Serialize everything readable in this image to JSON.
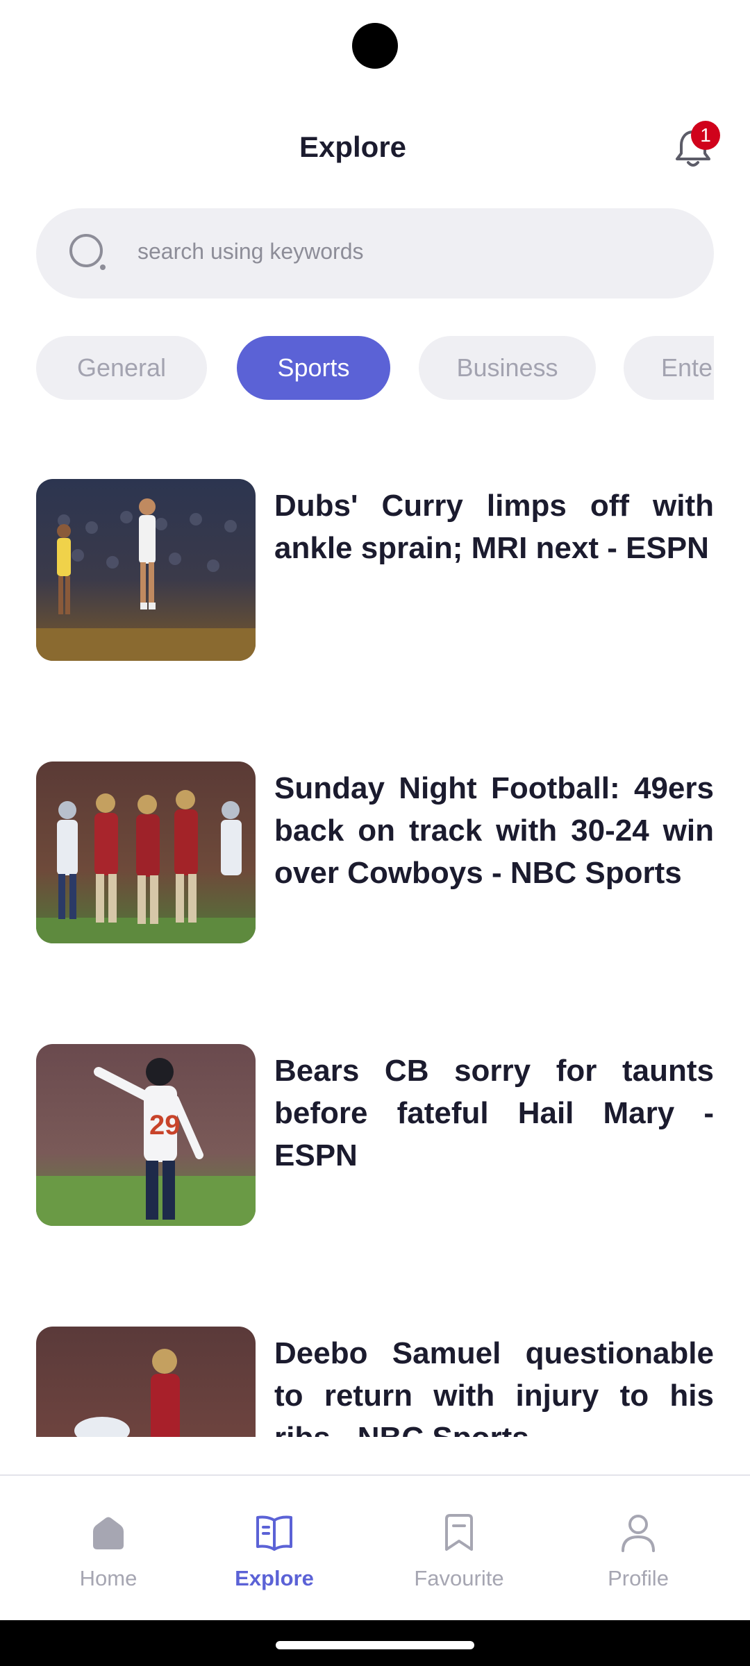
{
  "header": {
    "title": "Explore",
    "notification_count": "1"
  },
  "search": {
    "placeholder": "search using keywords"
  },
  "categories": [
    "General",
    "Sports",
    "Business",
    "Entertainment"
  ],
  "active_category": "Sports",
  "articles": [
    {
      "title": "Dubs' Curry limps off with ankle sprain; MRI next - ESPN"
    },
    {
      "title": "Sunday Night Football: 49ers back on track with 30-24 win over Cowboys - NBC Sports"
    },
    {
      "title": "Bears CB sorry for taunts before fateful Hail Mary - ESPN"
    },
    {
      "title": "Deebo Samuel questionable to return with injury to his ribs - NBC Sports"
    }
  ],
  "nav": {
    "items": [
      {
        "label": "Home",
        "icon": "home-icon"
      },
      {
        "label": "Explore",
        "icon": "book-icon"
      },
      {
        "label": "Favourite",
        "icon": "bookmark-icon"
      },
      {
        "label": "Profile",
        "icon": "person-icon"
      }
    ],
    "active": "Explore"
  },
  "colors": {
    "accent": "#5b62d6",
    "badge": "#d0021b",
    "chip_bg": "#efeff3",
    "text": "#1b1b2e"
  }
}
